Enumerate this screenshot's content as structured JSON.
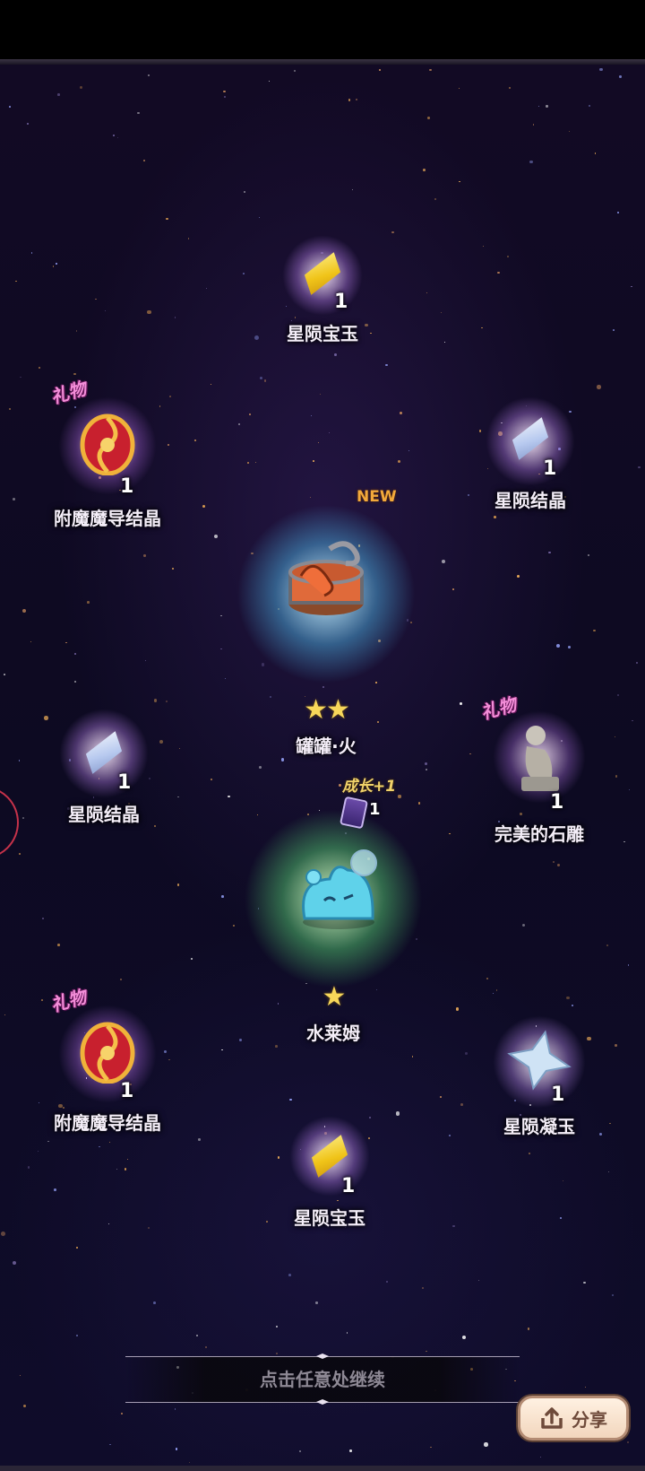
{
  "items": {
    "gem_top": {
      "name": "星陨宝玉",
      "qty": "1"
    },
    "enchant_top": {
      "gift_tag": "礼物",
      "name": "附魔魔导结晶",
      "qty": "1"
    },
    "crystal_right_top": {
      "name": "星陨结晶",
      "qty": "1"
    },
    "can_fire": {
      "new_tag": "NEW",
      "name": "罐罐·火",
      "rarity": "★★"
    },
    "crystal_left": {
      "name": "星陨结晶",
      "qty": "1"
    },
    "statue": {
      "gift_tag": "礼物",
      "name": "完美的石雕",
      "qty": "1"
    },
    "slime": {
      "growth_tag": "成长+1",
      "card_qty": "1",
      "name": "水莱姆",
      "rarity": "★"
    },
    "enchant_bottom": {
      "gift_tag": "礼物",
      "name": "附魔魔导结晶",
      "qty": "1"
    },
    "jade_right": {
      "name": "星陨凝玉",
      "qty": "1"
    },
    "gem_bottom": {
      "name": "星陨宝玉",
      "qty": "1"
    }
  },
  "continue_prompt": "点击任意处继续",
  "share_button": {
    "label": "分享",
    "icon": "share-upload-icon"
  },
  "colors": {
    "background": "#0b0718",
    "gift_tag": "#f48ed9",
    "new_tag": "#f2a93b",
    "growth_tag": "#f0d26a",
    "star_rating": "#f7d75a"
  }
}
